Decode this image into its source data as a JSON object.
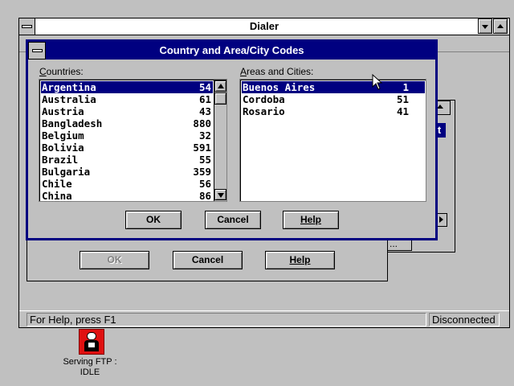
{
  "dialer": {
    "title": "Dialer",
    "status_help": "For Help, press F1",
    "status_state": "Disconnected"
  },
  "back_dialog": {
    "ok_label": "OK",
    "cancel_label": "Cancel",
    "help_label": "Help",
    "partial_button_text": "t",
    "partial_ellipsis": "..."
  },
  "country_dialog": {
    "title": "Country and Area/City Codes",
    "countries_label_mnemonic": "C",
    "countries_label_rest": "ountries:",
    "areas_label_mnemonic": "A",
    "areas_label_rest": "reas and Cities:",
    "countries": [
      {
        "name": "Argentina",
        "code": "54",
        "selected": true
      },
      {
        "name": "Australia",
        "code": "61"
      },
      {
        "name": "Austria",
        "code": "43"
      },
      {
        "name": "Bangladesh",
        "code": "880"
      },
      {
        "name": "Belgium",
        "code": "32"
      },
      {
        "name": "Bolivia",
        "code": "591"
      },
      {
        "name": "Brazil",
        "code": "55"
      },
      {
        "name": "Bulgaria",
        "code": "359"
      },
      {
        "name": "Chile",
        "code": "56"
      },
      {
        "name": "China",
        "code": "86"
      }
    ],
    "cities": [
      {
        "name": "Buenos Aires",
        "code": "1",
        "selected": true
      },
      {
        "name": "Cordoba",
        "code": "51"
      },
      {
        "name": "Rosario",
        "code": "41"
      }
    ],
    "ok_label": "OK",
    "cancel_label": "Cancel",
    "help_label": "Help"
  },
  "desktop": {
    "icon_label_line1": "Serving FTP :",
    "icon_label_line2": "IDLE"
  }
}
